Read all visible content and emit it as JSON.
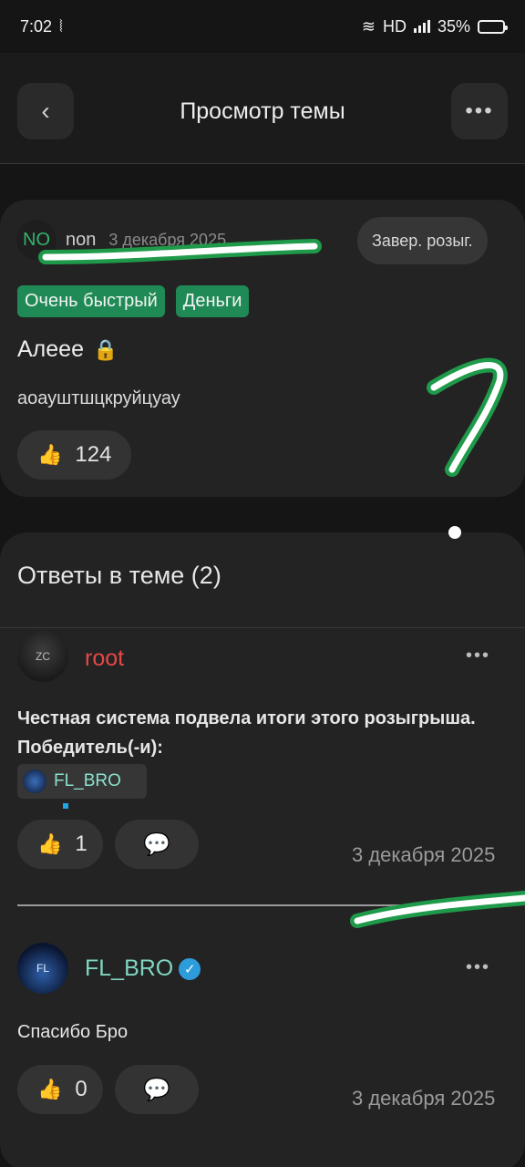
{
  "status_bar": {
    "time": "7:02",
    "network": "HD",
    "battery": "35%"
  },
  "header": {
    "title": "Просмотр темы",
    "back_glyph": "‹",
    "more_glyph": "•••"
  },
  "post": {
    "avatar_initials": "NO",
    "author": "non",
    "date": "3 декабря 2025",
    "status": "Завер. розыг.",
    "tags": [
      "Очень быстрый",
      "Деньги"
    ],
    "title": "Алеее",
    "body": "аоауштшцкруйцуау",
    "likes": "124"
  },
  "replies": {
    "title": "Ответы в теме (2)",
    "items": [
      {
        "author": "root",
        "text": "Честная система подвела итоги этого розыгрыша. Победитель(-и):",
        "winner": "FL_BRO",
        "likes": "1",
        "date": "3 декабря 2025"
      },
      {
        "author": "FL_BRO",
        "text": "Спасибо Бро",
        "likes": "0",
        "date": "3 декабря 2025"
      }
    ]
  },
  "colors": {
    "accent_green": "#1f8a55",
    "author_red": "#e84646",
    "author_teal": "#7fd6c2"
  }
}
